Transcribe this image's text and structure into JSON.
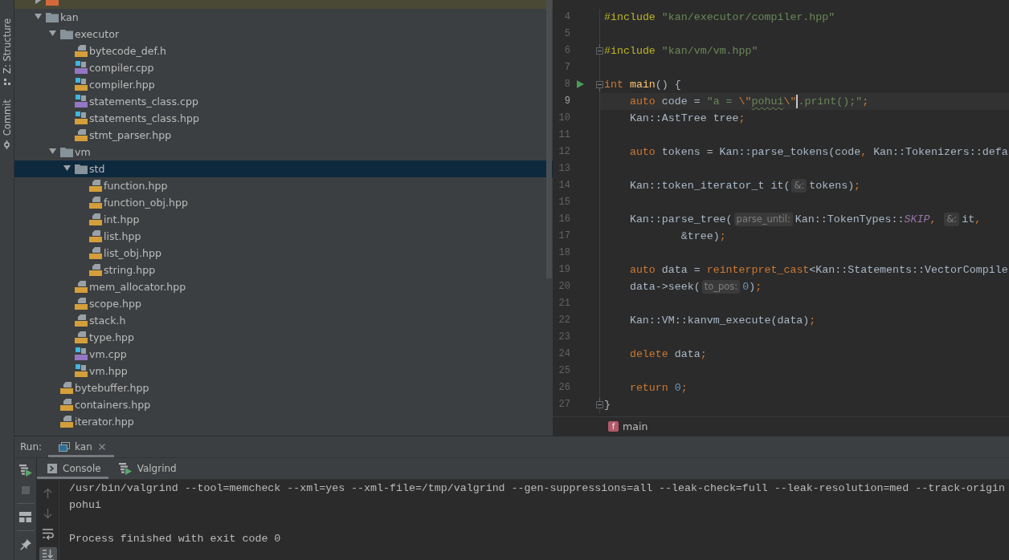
{
  "tool_strip": [
    {
      "label": "Z: Structure",
      "kind": "structure"
    },
    {
      "label": "Commit",
      "kind": "commit"
    }
  ],
  "project_tree": {
    "items": [
      {
        "kind": "excluded_folder",
        "expanded": false,
        "selected": false
      },
      {
        "name": "kan",
        "kind": "folder",
        "expanded": true,
        "selected": false,
        "children": [
          {
            "name": "executor",
            "kind": "folder",
            "expanded": true,
            "selected": false,
            "children": [
              {
                "name": "bytecode_def.h",
                "kind": "header",
                "marker": false,
                "selected": false
              },
              {
                "name": "compiler.cpp",
                "kind": "source",
                "marker": true,
                "selected": false
              },
              {
                "name": "compiler.hpp",
                "kind": "header",
                "marker": true,
                "selected": false
              },
              {
                "name": "statements_class.cpp",
                "kind": "source",
                "marker": true,
                "selected": false
              },
              {
                "name": "statements_class.hpp",
                "kind": "header",
                "marker": true,
                "selected": false
              },
              {
                "name": "stmt_parser.hpp",
                "kind": "header",
                "marker": false,
                "selected": false
              }
            ]
          },
          {
            "name": "vm",
            "kind": "folder",
            "expanded": true,
            "selected": false,
            "children": [
              {
                "name": "std",
                "kind": "folder",
                "expanded": true,
                "selected": true,
                "children": [
                  {
                    "name": "function.hpp",
                    "kind": "header",
                    "marker": false,
                    "selected": false
                  },
                  {
                    "name": "function_obj.hpp",
                    "kind": "header",
                    "marker": false,
                    "selected": false
                  },
                  {
                    "name": "int.hpp",
                    "kind": "header",
                    "marker": false,
                    "selected": false
                  },
                  {
                    "name": "list.hpp",
                    "kind": "header",
                    "marker": false,
                    "selected": false
                  },
                  {
                    "name": "list_obj.hpp",
                    "kind": "header",
                    "marker": false,
                    "selected": false
                  },
                  {
                    "name": "string.hpp",
                    "kind": "header",
                    "marker": false,
                    "selected": false
                  }
                ]
              },
              {
                "name": "mem_allocator.hpp",
                "kind": "header",
                "marker": false,
                "selected": false
              },
              {
                "name": "scope.hpp",
                "kind": "header",
                "marker": false,
                "selected": false
              },
              {
                "name": "stack.h",
                "kind": "header",
                "marker": false,
                "selected": false
              },
              {
                "name": "type.hpp",
                "kind": "header",
                "marker": false,
                "selected": false
              },
              {
                "name": "vm.cpp",
                "kind": "source",
                "marker": true,
                "selected": false
              },
              {
                "name": "vm.hpp",
                "kind": "header",
                "marker": true,
                "selected": false
              }
            ]
          },
          {
            "name": "bytebuffer.hpp",
            "kind": "header",
            "marker": false,
            "selected": false
          },
          {
            "name": "containers.hpp",
            "kind": "header",
            "marker": false,
            "selected": false
          },
          {
            "name": "iterator.hpp",
            "kind": "header",
            "marker": false,
            "selected": false
          }
        ]
      }
    ]
  },
  "editor": {
    "lines": [
      {
        "number": "4",
        "tokens": [
          {
            "text": "#include",
            "kind": "preprocessor"
          },
          {
            "text": " \"kan/executor/compiler.hpp\"",
            "kind": "string"
          }
        ]
      },
      {
        "number": "5"
      },
      {
        "number": "6",
        "fold_end": true,
        "tokens": [
          {
            "text": "#include",
            "kind": "preprocessor"
          },
          {
            "text": " \"kan/vm/vm.hpp\"",
            "kind": "string"
          }
        ]
      },
      {
        "number": "7"
      },
      {
        "number": "8",
        "run": true,
        "fold_start": true,
        "tokens": [
          {
            "text": "int ",
            "kind": "keyword"
          },
          {
            "text": "main",
            "kind": "function"
          },
          {
            "text": "() {",
            "kind": "plain"
          }
        ]
      },
      {
        "number": "9",
        "current": true,
        "tokens": [
          {
            "text": "    auto",
            "kind": "keyword"
          },
          {
            "text": " code = ",
            "kind": "plain"
          },
          {
            "text": "\"a = ",
            "kind": "string"
          },
          {
            "text": "\\\"",
            "kind": "escape"
          },
          {
            "text": "pohui",
            "kind": "typo_string"
          },
          {
            "text": "\\\"",
            "kind": "escape"
          },
          {
            "kind": "caret"
          },
          {
            "text": ".print();\"",
            "kind": "string"
          },
          {
            "text": ";",
            "kind": "punct"
          }
        ]
      },
      {
        "number": "10",
        "tokens": [
          {
            "text": "    Kan::AstTree tree",
            "kind": "plain"
          },
          {
            "text": ";",
            "kind": "punct"
          }
        ]
      },
      {
        "number": "11"
      },
      {
        "number": "12",
        "tokens": [
          {
            "text": "    auto",
            "kind": "keyword"
          },
          {
            "text": " tokens = Kan::parse_tokens(code",
            "kind": "plain"
          },
          {
            "text": ",",
            "kind": "punct"
          },
          {
            "text": " Kan::Tokenizers::defa",
            "kind": "plain"
          }
        ]
      },
      {
        "number": "13"
      },
      {
        "number": "14",
        "tokens": [
          {
            "text": "    Kan::token_iterator_t it(",
            "kind": "plain"
          },
          {
            "text": "&:",
            "kind": "hint"
          },
          {
            "text": "tokens)",
            "kind": "plain"
          },
          {
            "text": ";",
            "kind": "punct"
          }
        ]
      },
      {
        "number": "15"
      },
      {
        "number": "16",
        "tokens": [
          {
            "text": "    Kan::parse_tree(",
            "kind": "plain"
          },
          {
            "text": "parse_until:",
            "kind": "hint"
          },
          {
            "text": "Kan::TokenTypes::",
            "kind": "plain"
          },
          {
            "text": "SKIP",
            "kind": "constant"
          },
          {
            "text": ", ",
            "kind": "punct"
          },
          {
            "text": "&:",
            "kind": "hint"
          },
          {
            "text": "it",
            "kind": "plain"
          },
          {
            "text": ",",
            "kind": "punct"
          }
        ]
      },
      {
        "number": "17",
        "tokens": [
          {
            "text": "            &tree)",
            "kind": "plain"
          },
          {
            "text": ";",
            "kind": "punct"
          }
        ]
      },
      {
        "number": "18"
      },
      {
        "number": "19",
        "tokens": [
          {
            "text": "    auto",
            "kind": "keyword"
          },
          {
            "text": " data = ",
            "kind": "plain"
          },
          {
            "text": "reinterpret_cast",
            "kind": "keyword"
          },
          {
            "text": "<Kan::Statements::VectorCompile",
            "kind": "plain"
          }
        ]
      },
      {
        "number": "20",
        "tokens": [
          {
            "text": "    data->seek(",
            "kind": "plain"
          },
          {
            "text": "to_pos:",
            "kind": "hint"
          },
          {
            "text": "0",
            "kind": "number"
          },
          {
            "text": ")",
            "kind": "plain"
          },
          {
            "text": ";",
            "kind": "punct"
          }
        ]
      },
      {
        "number": "21"
      },
      {
        "number": "22",
        "tokens": [
          {
            "text": "    Kan::VM::kanvm_execute(data)",
            "kind": "plain"
          },
          {
            "text": ";",
            "kind": "punct"
          }
        ]
      },
      {
        "number": "23"
      },
      {
        "number": "24",
        "tokens": [
          {
            "text": "    delete",
            "kind": "keyword"
          },
          {
            "text": " data",
            "kind": "plain"
          },
          {
            "text": ";",
            "kind": "punct"
          }
        ]
      },
      {
        "number": "25"
      },
      {
        "number": "26",
        "tokens": [
          {
            "text": "    return ",
            "kind": "keyword"
          },
          {
            "text": "0",
            "kind": "number"
          },
          {
            "text": ";",
            "kind": "punct"
          }
        ]
      },
      {
        "number": "27",
        "fold_end": true,
        "tokens": [
          {
            "text": "}",
            "kind": "plain"
          }
        ]
      }
    ],
    "breadcrumb": {
      "icon_label": "f",
      "label": "main"
    }
  },
  "run_panel": {
    "title": "Run:",
    "tabs": [
      {
        "label": "kan",
        "selected": true
      }
    ],
    "toolbar": [
      {
        "kind": "rerun",
        "disabled": false
      },
      {
        "kind": "stop",
        "disabled": true
      },
      {
        "kind": "layout",
        "disabled": false
      },
      {
        "kind": "pin",
        "disabled": false
      }
    ],
    "subtabs": [
      {
        "label": "Console",
        "kind": "console",
        "selected": true
      },
      {
        "label": "Valgrind",
        "kind": "valgrind",
        "selected": false
      }
    ],
    "console_toolbar": [
      {
        "kind": "up",
        "disabled": true,
        "on": false
      },
      {
        "kind": "down",
        "disabled": true,
        "on": false
      },
      {
        "kind": "soft_wrap",
        "disabled": false,
        "on": false
      },
      {
        "kind": "scroll_to_end",
        "disabled": false,
        "on": true
      }
    ],
    "output": [
      [
        "/usr/bin/valgrind --tool=memcheck --xml=yes --xml-file=/tmp/valgrind --gen-suppressions=all --leak-check=full --leak-resolution=med --track-origin",
        "pohui"
      ],
      [
        "Process finished with exit code 0"
      ]
    ]
  }
}
